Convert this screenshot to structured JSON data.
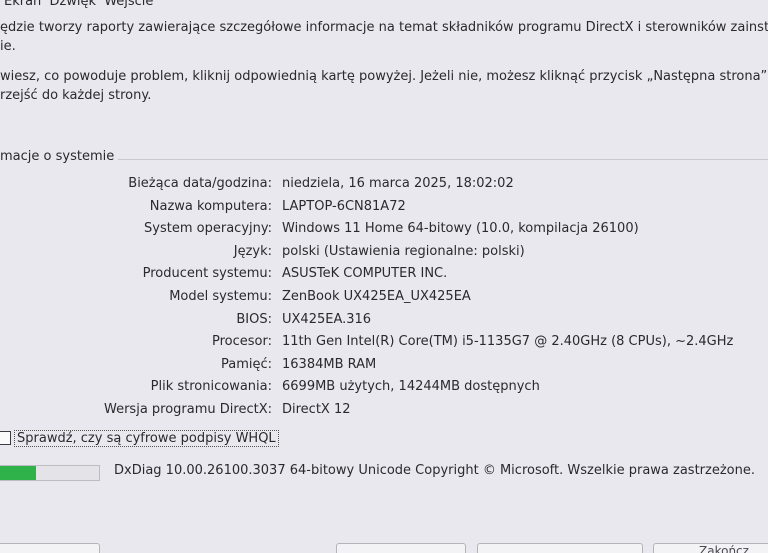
{
  "tabs": {
    "screen": "Ekran",
    "sound": "Dźwięk",
    "input": "Wejście"
  },
  "intro": {
    "line1": "ędzie tworzy raporty zawierające szczegółowe informacje na temat składników programu DirectX i sterowników zainstalowanych w",
    "line1b": "ie.",
    "line2": "wiesz, co powoduje problem, kliknij odpowiednią kartę powyżej. Jeżeli nie, możesz kliknąć przycisk „Następna strona” poniżej, aby po",
    "line2b": "rzejść do każdej strony."
  },
  "system_info": {
    "group_title": "macje o systemie",
    "rows": [
      {
        "label": "Bieżąca data/godzina:",
        "value": "niedziela, 16 marca 2025, 18:02:02"
      },
      {
        "label": "Nazwa komputera:",
        "value": "LAPTOP-6CN81A72"
      },
      {
        "label": "System operacyjny:",
        "value": "Windows 11 Home 64-bitowy (10.0, kompilacja 26100)"
      },
      {
        "label": "Język:",
        "value": "polski (Ustawienia regionalne: polski)"
      },
      {
        "label": "Producent systemu:",
        "value": "ASUSTeK COMPUTER INC."
      },
      {
        "label": "Model systemu:",
        "value": "ZenBook UX425EA_UX425EA"
      },
      {
        "label": "BIOS:",
        "value": "UX425EA.316"
      },
      {
        "label": "Procesor:",
        "value": "11th Gen Intel(R) Core(TM) i5-1135G7 @ 2.40GHz (8 CPUs), ~2.4GHz"
      },
      {
        "label": "Pamięć:",
        "value": "16384MB RAM"
      },
      {
        "label": "Plik stronicowania:",
        "value": "6699MB użytych, 14244MB dostępnych"
      },
      {
        "label": "Wersja programu DirectX:",
        "value": "DirectX 12"
      }
    ]
  },
  "whql_checkbox": {
    "label": "Sprawdź, czy są cyfrowe podpisy WHQL",
    "checked": false
  },
  "progress": {
    "fraction": 0.36,
    "color": "#2fb24a"
  },
  "copyright": "DxDiag 10.00.26100.3037 64-bitowy Unicode  Copyright © Microsoft. Wszelkie prawa zastrzeżone.",
  "buttons": {
    "help": "",
    "next": "",
    "save": "...",
    "exit": "Zakończ"
  }
}
